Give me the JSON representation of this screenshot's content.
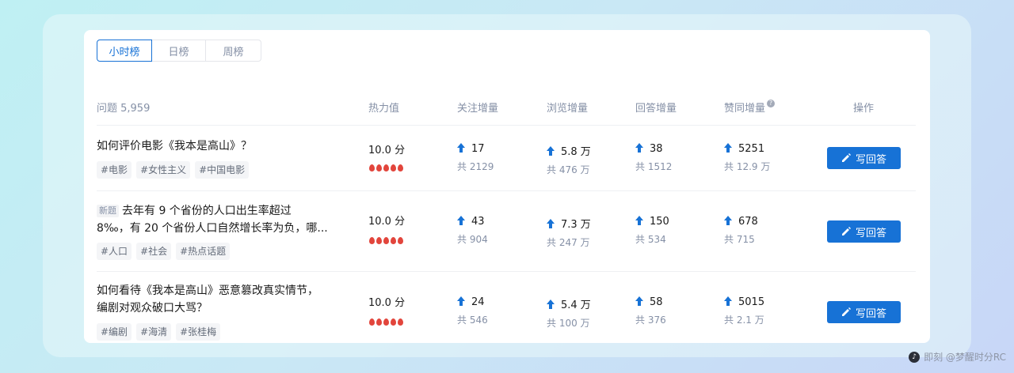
{
  "tabs": [
    {
      "label": "小时榜",
      "active": true
    },
    {
      "label": "日榜",
      "active": false
    },
    {
      "label": "周榜",
      "active": false
    }
  ],
  "columns": {
    "question": "问题 5,959",
    "heat": "热力值",
    "follow": "关注增量",
    "view": "浏览增量",
    "answer": "回答增量",
    "upvote": "赞同增量",
    "action": "操作"
  },
  "rows": [
    {
      "new_label": "",
      "title_line1": "如何评价电影《我本是高山》？",
      "title_line2": "",
      "tags": [
        "#电影",
        "#女性主义",
        "#中国电影"
      ],
      "heat": "10.0 分",
      "heat_level": 5,
      "follow": {
        "inc": "17",
        "total": "共 2129"
      },
      "view": {
        "inc": "5.8 万",
        "total": "共 476 万"
      },
      "answer": {
        "inc": "38",
        "total": "共 1512"
      },
      "upvote": {
        "inc": "5251",
        "total": "共 12.9 万"
      },
      "button": "写回答"
    },
    {
      "new_label": "新题",
      "title_line1": "去年有 9 个省份的人口出生率超过",
      "title_line2": "8‰，有 20 个省份人口自然增长率为负，哪...",
      "tags": [
        "#人口",
        "#社会",
        "#热点话题"
      ],
      "heat": "10.0 分",
      "heat_level": 5,
      "follow": {
        "inc": "43",
        "total": "共 904"
      },
      "view": {
        "inc": "7.3 万",
        "total": "共 247 万"
      },
      "answer": {
        "inc": "150",
        "total": "共 534"
      },
      "upvote": {
        "inc": "678",
        "total": "共 715"
      },
      "button": "写回答"
    },
    {
      "new_label": "",
      "title_line1": "如何看待《我本是高山》恶意篡改真实情节，",
      "title_line2": "编剧对观众破口大骂？",
      "tags": [
        "#编剧",
        "#海清",
        "#张桂梅"
      ],
      "heat": "10.0 分",
      "heat_level": 5,
      "follow": {
        "inc": "24",
        "total": "共 546"
      },
      "view": {
        "inc": "5.4 万",
        "total": "共 100 万"
      },
      "answer": {
        "inc": "58",
        "total": "共 376"
      },
      "upvote": {
        "inc": "5015",
        "total": "共 2.1 万"
      },
      "button": "写回答"
    }
  ],
  "watermark": "即刻 @梦醒时分RC",
  "colors": {
    "accent": "#1772d6",
    "flame": "#e2453c",
    "muted": "#8590a6"
  }
}
